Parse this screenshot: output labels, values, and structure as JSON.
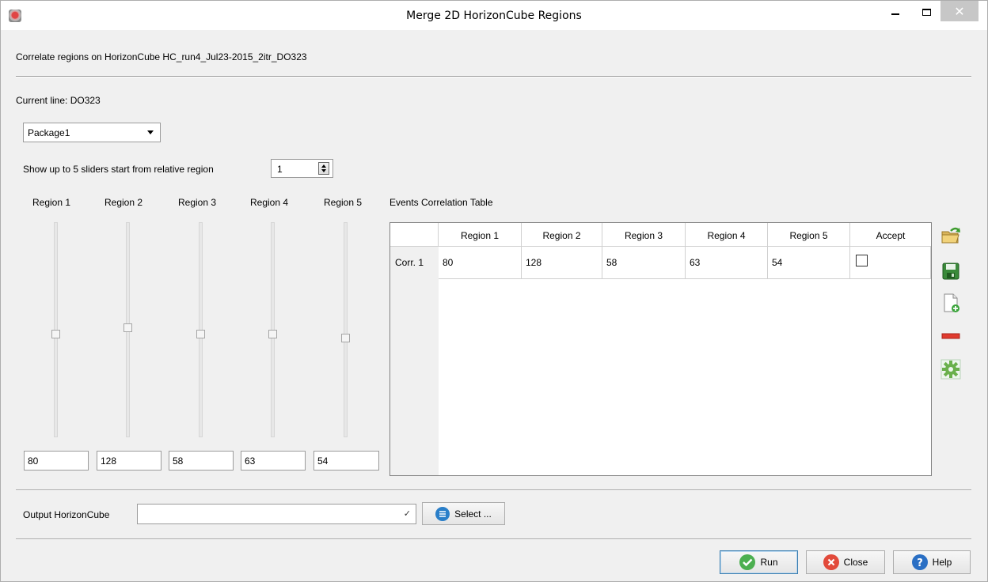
{
  "window": {
    "title": "Merge 2D HorizonCube Regions",
    "close_glyph": "✕"
  },
  "header": {
    "description": "Correlate regions on HorizonCube HC_run4_Jul23-2015_2itr_DO323",
    "current_line": "Current line: DO323"
  },
  "package_select": {
    "value": "Package1"
  },
  "slider_controls": {
    "label": "Show up to 5 sliders start from relative region",
    "start_value": "1"
  },
  "sliders": [
    {
      "label": "Region 1",
      "value": "80",
      "level": 0.52
    },
    {
      "label": "Region 2",
      "value": "128",
      "level": 0.49
    },
    {
      "label": "Region 3",
      "value": "58",
      "level": 0.52
    },
    {
      "label": "Region 4",
      "value": "63",
      "level": 0.52
    },
    {
      "label": "Region 5",
      "value": "54",
      "level": 0.54
    }
  ],
  "table": {
    "title": "Events Correlation Table",
    "columns": [
      "Region 1",
      "Region 2",
      "Region 3",
      "Region 4",
      "Region 5",
      "Accept"
    ],
    "rows": [
      {
        "label": "Corr. 1",
        "values": [
          "80",
          "128",
          "58",
          "63",
          "54"
        ],
        "accept": false
      }
    ]
  },
  "toolbar": {
    "icons": [
      "open-folder-icon",
      "save-icon",
      "new-document-icon",
      "remove-icon",
      "settings-gear-icon"
    ]
  },
  "output": {
    "label": "Output HorizonCube",
    "value": "",
    "select_label": "Select ..."
  },
  "buttons": {
    "run": "Run",
    "close": "Close",
    "help": "Help"
  },
  "colors": {
    "accent": "#3c7fb1",
    "run_green": "#4caf50",
    "close_red": "#e24a3b",
    "help_blue": "#2a6fc4",
    "remove_red": "#e03a2e"
  }
}
